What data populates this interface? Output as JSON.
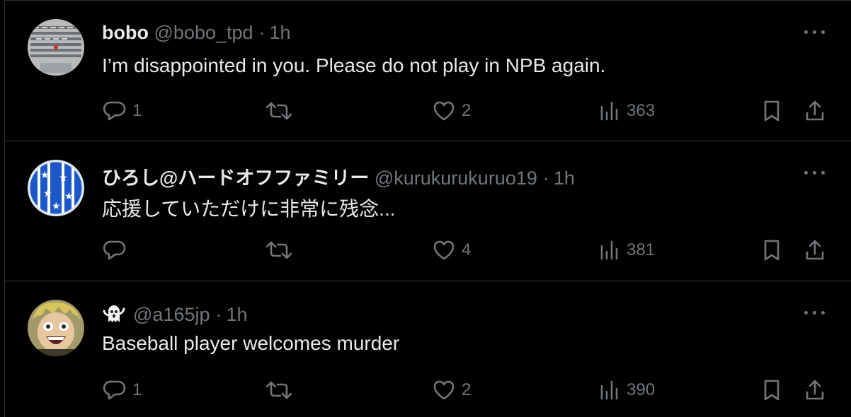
{
  "tweets": [
    {
      "name": "bobo",
      "handle": "@bobo_tpd",
      "time": "1h",
      "text": "I’m disappointed in you. Please do not play in NPB again.",
      "replies": "1",
      "retweets": "",
      "likes": "2",
      "views": "363",
      "avatar": "keyboard-photo"
    },
    {
      "name": "ひろし@ハードオフファミリー",
      "handle": "@kurukurukuruo19",
      "time": "1h",
      "text": "応援していただけに非常に残念...",
      "replies": "",
      "retweets": "",
      "likes": "4",
      "views": "381",
      "avatar": "blue-star-jersey"
    },
    {
      "name": "",
      "name_icon": "ghost-icon",
      "handle": "@a165jp",
      "time": "1h",
      "text": "Baseball player welcomes murder",
      "replies": "1",
      "retweets": "",
      "likes": "2",
      "views": "390",
      "avatar": "anime-character"
    }
  ],
  "separator": "·",
  "colors": {
    "background": "#000000",
    "text": "#e7e9ea",
    "secondary": "#71767b",
    "border": "#2f3336"
  }
}
